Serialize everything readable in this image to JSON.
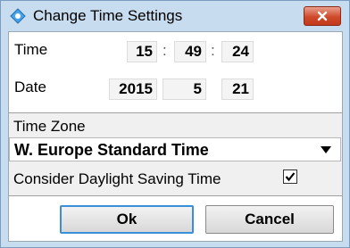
{
  "window": {
    "title": "Change Time Settings",
    "close_icon": "close-icon",
    "colors": {
      "frame": "#c7dcef",
      "close": "#cf4a2a",
      "focus": "#3b8ed8"
    }
  },
  "time": {
    "label": "Time",
    "hour": "15",
    "minute": "49",
    "second": "24",
    "separator": ":"
  },
  "date": {
    "label": "Date",
    "year": "2015",
    "month": "5",
    "day": "21"
  },
  "timezone": {
    "label": "Time Zone",
    "value": "W. Europe Standard Time",
    "dst_label": "Consider Daylight Saving Time",
    "dst_checked": true
  },
  "buttons": {
    "ok": "Ok",
    "cancel": "Cancel"
  }
}
